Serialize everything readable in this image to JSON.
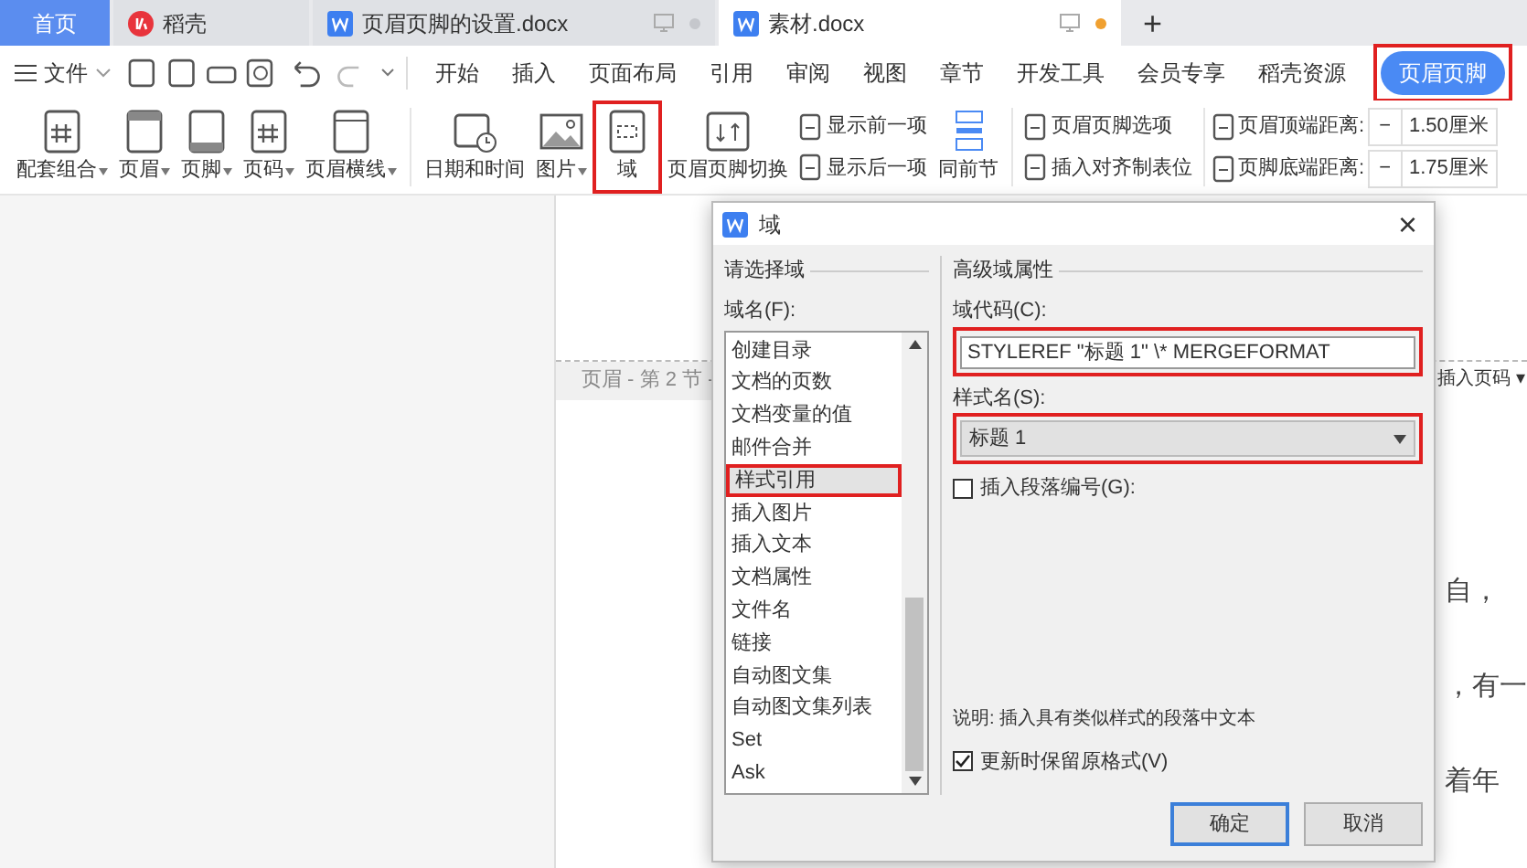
{
  "tabs": [
    {
      "label": "首页",
      "kind": "home",
      "selected": false
    },
    {
      "label": "稻壳",
      "kind": "app",
      "selected": false
    },
    {
      "label": "页眉页脚的设置.docx",
      "kind": "doc",
      "selected": false,
      "dot": false
    },
    {
      "label": "素材.docx",
      "kind": "doc",
      "selected": true,
      "dot": true
    }
  ],
  "new_tab": "+",
  "menu": {
    "file": "文件",
    "items": [
      {
        "label": "开始",
        "selected": false,
        "highlighted": false
      },
      {
        "label": "插入",
        "selected": false,
        "highlighted": false
      },
      {
        "label": "页面布局",
        "selected": false,
        "highlighted": false
      },
      {
        "label": "引用",
        "selected": false,
        "highlighted": false
      },
      {
        "label": "审阅",
        "selected": false,
        "highlighted": false
      },
      {
        "label": "视图",
        "selected": false,
        "highlighted": false
      },
      {
        "label": "章节",
        "selected": false,
        "highlighted": false
      },
      {
        "label": "开发工具",
        "selected": false,
        "highlighted": false
      },
      {
        "label": "会员专享",
        "selected": false,
        "highlighted": false
      },
      {
        "label": "稻壳资源",
        "selected": false,
        "highlighted": false
      },
      {
        "label": "页眉页脚",
        "selected": true,
        "highlighted": true
      }
    ]
  },
  "ribbon": {
    "big": [
      {
        "label": "配套组合",
        "dropdown": true,
        "highlighted": false
      },
      {
        "label": "页眉",
        "dropdown": true,
        "highlighted": false
      },
      {
        "label": "页脚",
        "dropdown": true,
        "highlighted": false
      },
      {
        "label": "页码",
        "dropdown": true,
        "highlighted": false
      },
      {
        "label": "页眉横线",
        "dropdown": true,
        "highlighted": false
      },
      {
        "label": "日期和时间",
        "dropdown": false,
        "highlighted": false
      },
      {
        "label": "图片",
        "dropdown": true,
        "highlighted": false
      },
      {
        "label": "域",
        "dropdown": false,
        "highlighted": true
      },
      {
        "label": "页眉页脚切换",
        "dropdown": false,
        "highlighted": false
      }
    ],
    "small": [
      [
        "显示前一项",
        "显示后一项"
      ],
      [
        "页眉页脚选项",
        "插入对齐制表位"
      ]
    ],
    "same_prev": "同前节",
    "distances": [
      {
        "label": "页眉顶端距离:",
        "minus": "−",
        "value": "1.50厘米"
      },
      {
        "label": "页脚底端距离:",
        "minus": "−",
        "value": "1.75厘米"
      }
    ]
  },
  "document": {
    "header_label": "页眉 - 第 2 节 -",
    "insert_page_number": "插入页码 ▾",
    "text_fragments": [
      "自，",
      "，有一",
      "着年"
    ]
  },
  "dialog": {
    "title": "域",
    "close": "×",
    "left_section": "请选择域",
    "list_label": "域名(F):",
    "fields": [
      {
        "label": "创建目录",
        "selected": false,
        "highlighted": false
      },
      {
        "label": "文档的页数",
        "selected": false,
        "highlighted": false
      },
      {
        "label": "文档变量的值",
        "selected": false,
        "highlighted": false
      },
      {
        "label": "邮件合并",
        "selected": false,
        "highlighted": false
      },
      {
        "label": "样式引用",
        "selected": true,
        "highlighted": true
      },
      {
        "label": "插入图片",
        "selected": false,
        "highlighted": false
      },
      {
        "label": "插入文本",
        "selected": false,
        "highlighted": false
      },
      {
        "label": "文档属性",
        "selected": false,
        "highlighted": false
      },
      {
        "label": "文件名",
        "selected": false,
        "highlighted": false
      },
      {
        "label": "链接",
        "selected": false,
        "highlighted": false
      },
      {
        "label": "自动图文集",
        "selected": false,
        "highlighted": false
      },
      {
        "label": "自动图文集列表",
        "selected": false,
        "highlighted": false
      },
      {
        "label": "Set",
        "selected": false,
        "highlighted": false
      },
      {
        "label": "Ask",
        "selected": false,
        "highlighted": false
      }
    ],
    "right_section": "高级域属性",
    "code_label": "域代码(C):",
    "code_value": "STYLEREF \"标题 1\" \\* MERGEFORMAT",
    "code_highlighted": true,
    "style_label": "样式名(S):",
    "style_value": "标题 1",
    "style_highlighted": true,
    "para_number": {
      "label": "插入段落编号(G):",
      "checked": false
    },
    "description": "说明: 插入具有类似样式的段落中文本",
    "keep_format": {
      "label": "更新时保留原格式(V)",
      "checked": true
    },
    "ok": "确定",
    "cancel": "取消"
  }
}
